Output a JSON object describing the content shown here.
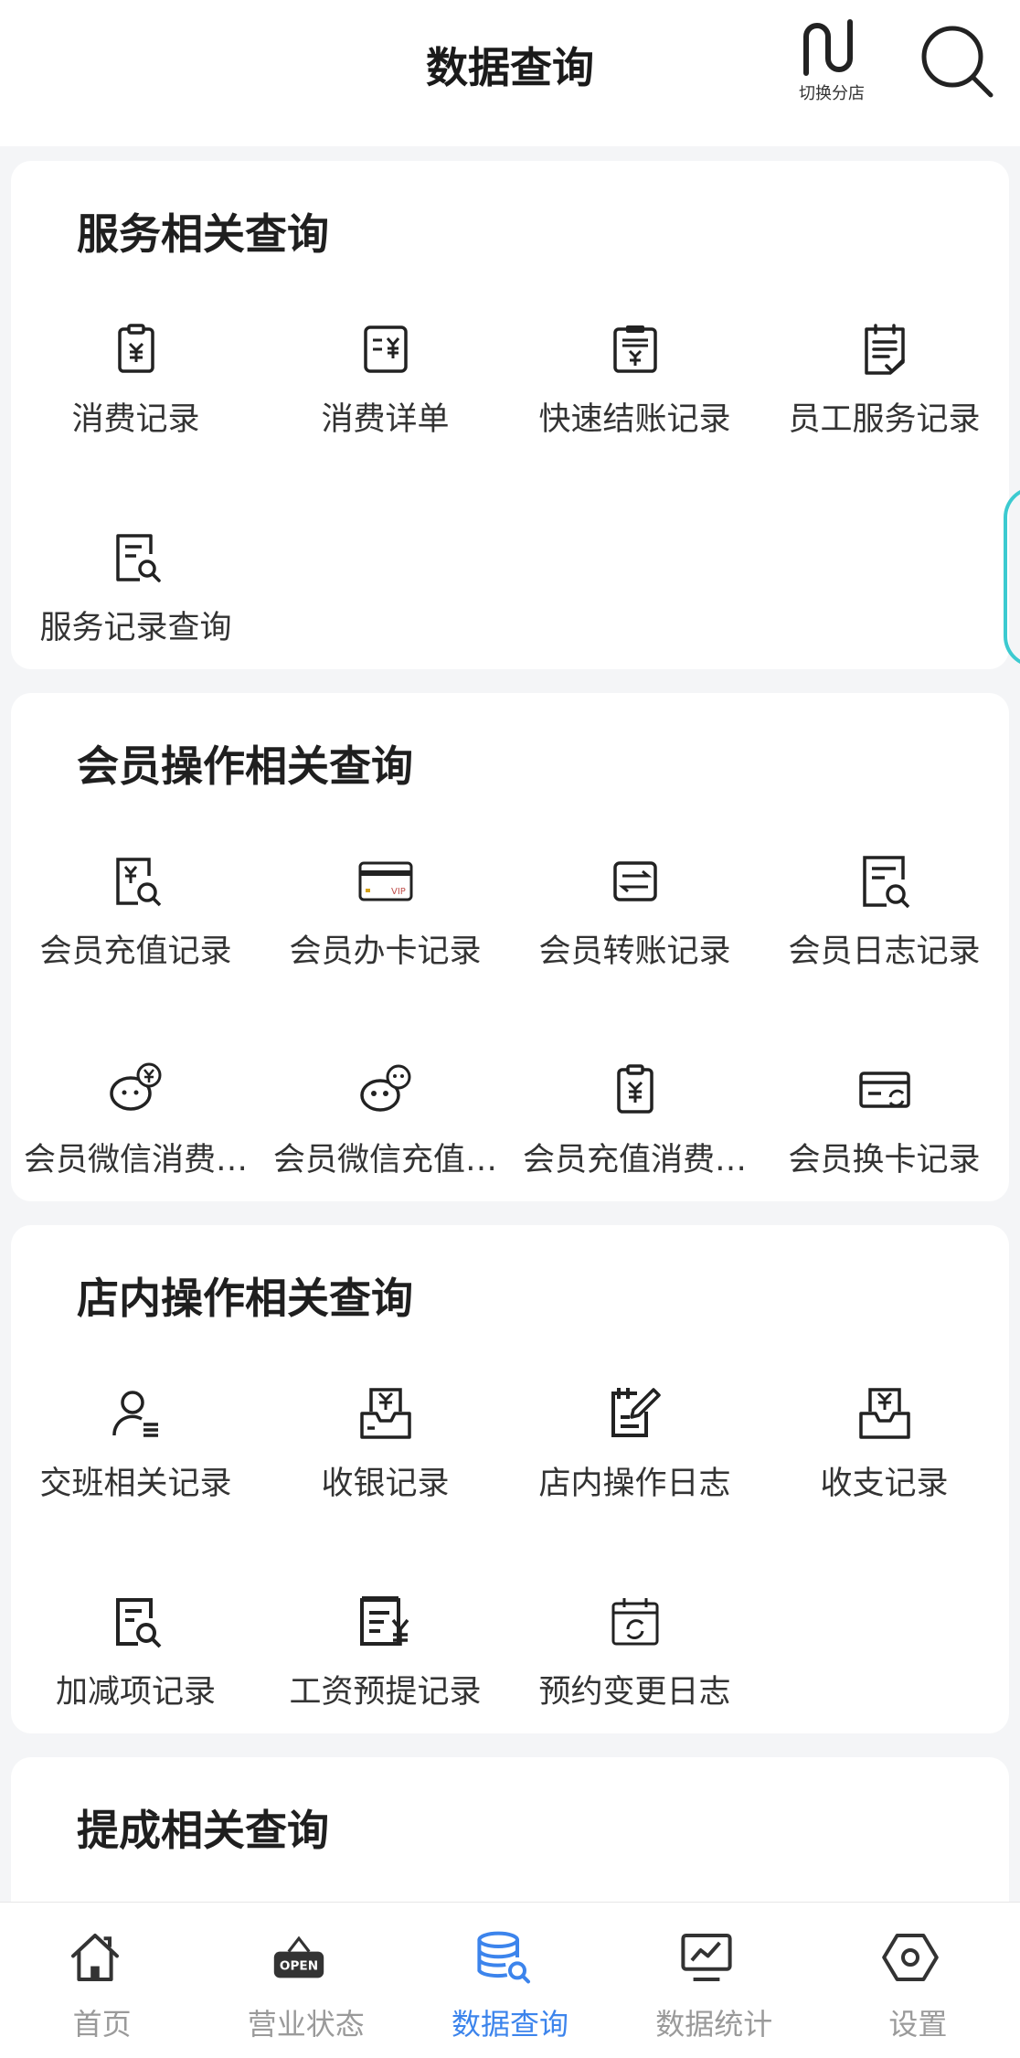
{
  "header": {
    "title": "数据查询",
    "switch_store_label": "切换分店"
  },
  "sections": [
    {
      "title": "服务相关查询",
      "items": [
        {
          "label": "消费记录",
          "icon": "clipboard-yen-icon"
        },
        {
          "label": "消费详单",
          "icon": "receipt-yen-icon"
        },
        {
          "label": "快速结账记录",
          "icon": "checkout-board-icon"
        },
        {
          "label": "员工服务记录",
          "icon": "staff-service-icon"
        },
        {
          "label": "服务记录查询",
          "icon": "doc-search-icon"
        }
      ]
    },
    {
      "title": "会员操作相关查询",
      "items": [
        {
          "label": "会员充值记录",
          "icon": "recharge-search-icon"
        },
        {
          "label": "会员办卡记录",
          "icon": "vip-card-icon"
        },
        {
          "label": "会员转账记录",
          "icon": "transfer-icon"
        },
        {
          "label": "会员日志记录",
          "icon": "log-search-icon"
        },
        {
          "label": "会员微信消费…",
          "icon": "wechat-yen-icon"
        },
        {
          "label": "会员微信充值…",
          "icon": "wechat-recharge-icon"
        },
        {
          "label": "会员充值消费…",
          "icon": "clipboard-yen-icon"
        },
        {
          "label": "会员换卡记录",
          "icon": "card-change-icon"
        }
      ]
    },
    {
      "title": "店内操作相关查询",
      "items": [
        {
          "label": "交班相关记录",
          "icon": "shift-user-icon"
        },
        {
          "label": "收银记录",
          "icon": "cashier-icon"
        },
        {
          "label": "店内操作日志",
          "icon": "edit-log-icon"
        },
        {
          "label": "收支记录",
          "icon": "income-expense-icon"
        },
        {
          "label": "加减项记录",
          "icon": "adjust-search-icon"
        },
        {
          "label": "工资预提记录",
          "icon": "salary-icon"
        },
        {
          "label": "预约变更日志",
          "icon": "calendar-refresh-icon"
        }
      ]
    },
    {
      "title": "提成相关查询",
      "items": []
    }
  ],
  "tabbar": [
    {
      "label": "首页",
      "icon": "home-icon",
      "active": false
    },
    {
      "label": "营业状态",
      "icon": "open-sign-icon",
      "active": false
    },
    {
      "label": "数据查询",
      "icon": "database-search-icon",
      "active": true
    },
    {
      "label": "数据统计",
      "icon": "chart-icon",
      "active": false
    },
    {
      "label": "设置",
      "icon": "settings-hex-icon",
      "active": false
    }
  ],
  "colors": {
    "accent": "#3c84ec",
    "inactive": "#9a9a9a",
    "handle": "#3ccad0"
  },
  "tab_open_text": "OPEN"
}
